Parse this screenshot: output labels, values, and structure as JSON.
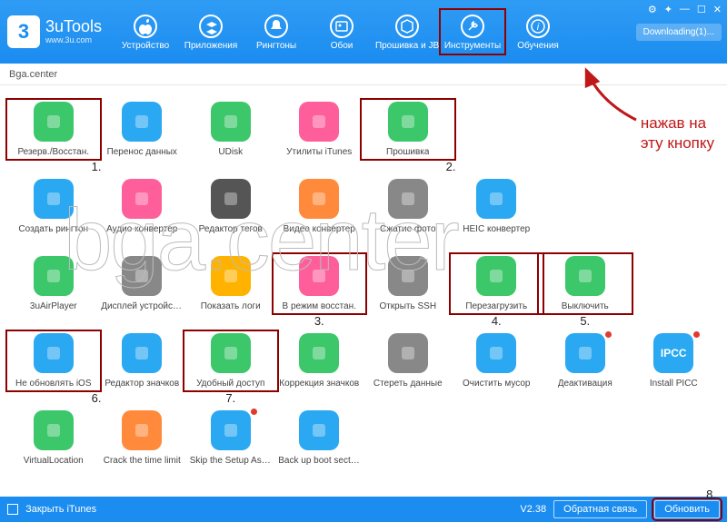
{
  "app": {
    "name": "3uTools",
    "site": "www.3u.com"
  },
  "window": {
    "controls": [
      "⚙",
      "✦",
      "—",
      "☐",
      "✕"
    ],
    "downloading": "Downloading(1)..."
  },
  "nav": [
    {
      "label": "Устройство",
      "icon": "apple"
    },
    {
      "label": "Приложения",
      "icon": "apps"
    },
    {
      "label": "Рингтоны",
      "icon": "bell"
    },
    {
      "label": "Обои",
      "icon": "image"
    },
    {
      "label": "Прошивка и JB",
      "icon": "box"
    },
    {
      "label": "Инструменты",
      "icon": "tools",
      "active": true
    },
    {
      "label": "Обучения",
      "icon": "info"
    }
  ],
  "breadcrumb": "Bga.center",
  "tools": [
    {
      "label": "Резерв./Восстан.",
      "c": "#3cc76a",
      "hl": true,
      "num": "1.",
      "numPos": "br"
    },
    {
      "label": "Перенос данных",
      "c": "#2aa8f2"
    },
    {
      "label": "UDisk",
      "c": "#3cc76a"
    },
    {
      "label": "Утилиты iTunes",
      "c": "#fe5f9a"
    },
    {
      "label": "Прошивка",
      "c": "#3cc76a",
      "hl": true,
      "num": "2.",
      "numPos": "br"
    },
    null,
    null,
    null,
    {
      "label": "Создать рингтон",
      "c": "#2aa8f2"
    },
    {
      "label": "Аудио конвертер",
      "c": "#fe5f9a"
    },
    {
      "label": "Редактор тегов",
      "c": "#555"
    },
    {
      "label": "Видео конвертер",
      "c": "#ff8a3c"
    },
    {
      "label": "Сжатие фото",
      "c": "#888"
    },
    {
      "label": "HEIC конвертер",
      "c": "#2aa8f2"
    },
    null,
    null,
    {
      "label": "3uAirPlayer",
      "c": "#3cc76a"
    },
    {
      "label": "Дисплей устройства",
      "c": "#888"
    },
    {
      "label": "Показать логи",
      "c": "#ffb300"
    },
    {
      "label": "В режим восстан.",
      "c": "#fe5f9a",
      "hl": true,
      "num": "3.",
      "numPos": "b"
    },
    {
      "label": "Открыть SSH",
      "c": "#888"
    },
    {
      "label": "Перезагрузить",
      "c": "#3cc76a",
      "hl": true,
      "num": "4.",
      "numPos": "b"
    },
    {
      "label": "Выключить",
      "c": "#3cc76a",
      "hl": true,
      "num": "5.",
      "numPos": "b"
    },
    null,
    {
      "label": "Не обновлять iOS",
      "c": "#2aa8f2",
      "hl": true,
      "num": "6.",
      "numPos": "br"
    },
    {
      "label": "Редактор значков",
      "c": "#2aa8f2"
    },
    {
      "label": "Удобный доступ",
      "c": "#3cc76a",
      "hl": true,
      "num": "7.",
      "numPos": "b"
    },
    {
      "label": "Коррекция значков",
      "c": "#3cc76a"
    },
    {
      "label": "Стереть данные",
      "c": "#888"
    },
    {
      "label": "Очистить мусор",
      "c": "#2aa8f2"
    },
    {
      "label": "Деактивация",
      "c": "#2aa8f2",
      "dot": true
    },
    {
      "label": "Install PICC",
      "c": "#2aa8f2",
      "dot": true,
      "text": "IPCC"
    },
    {
      "label": "VirtualLocation",
      "c": "#3cc76a"
    },
    {
      "label": "Crack the time limit",
      "c": "#ff8a3c"
    },
    {
      "label": "Skip the Setup Assistant",
      "c": "#2aa8f2",
      "dot": true
    },
    {
      "label": "Back up boot sector dat",
      "c": "#2aa8f2"
    }
  ],
  "annotation": {
    "line1": "нажав на",
    "line2": "эту кнопку"
  },
  "footer": {
    "closeItunes": "Закрыть iTunes",
    "version": "V2.38",
    "feedback": "Обратная связь",
    "update": "Обновить",
    "num": "8."
  },
  "watermark": "bga.center"
}
